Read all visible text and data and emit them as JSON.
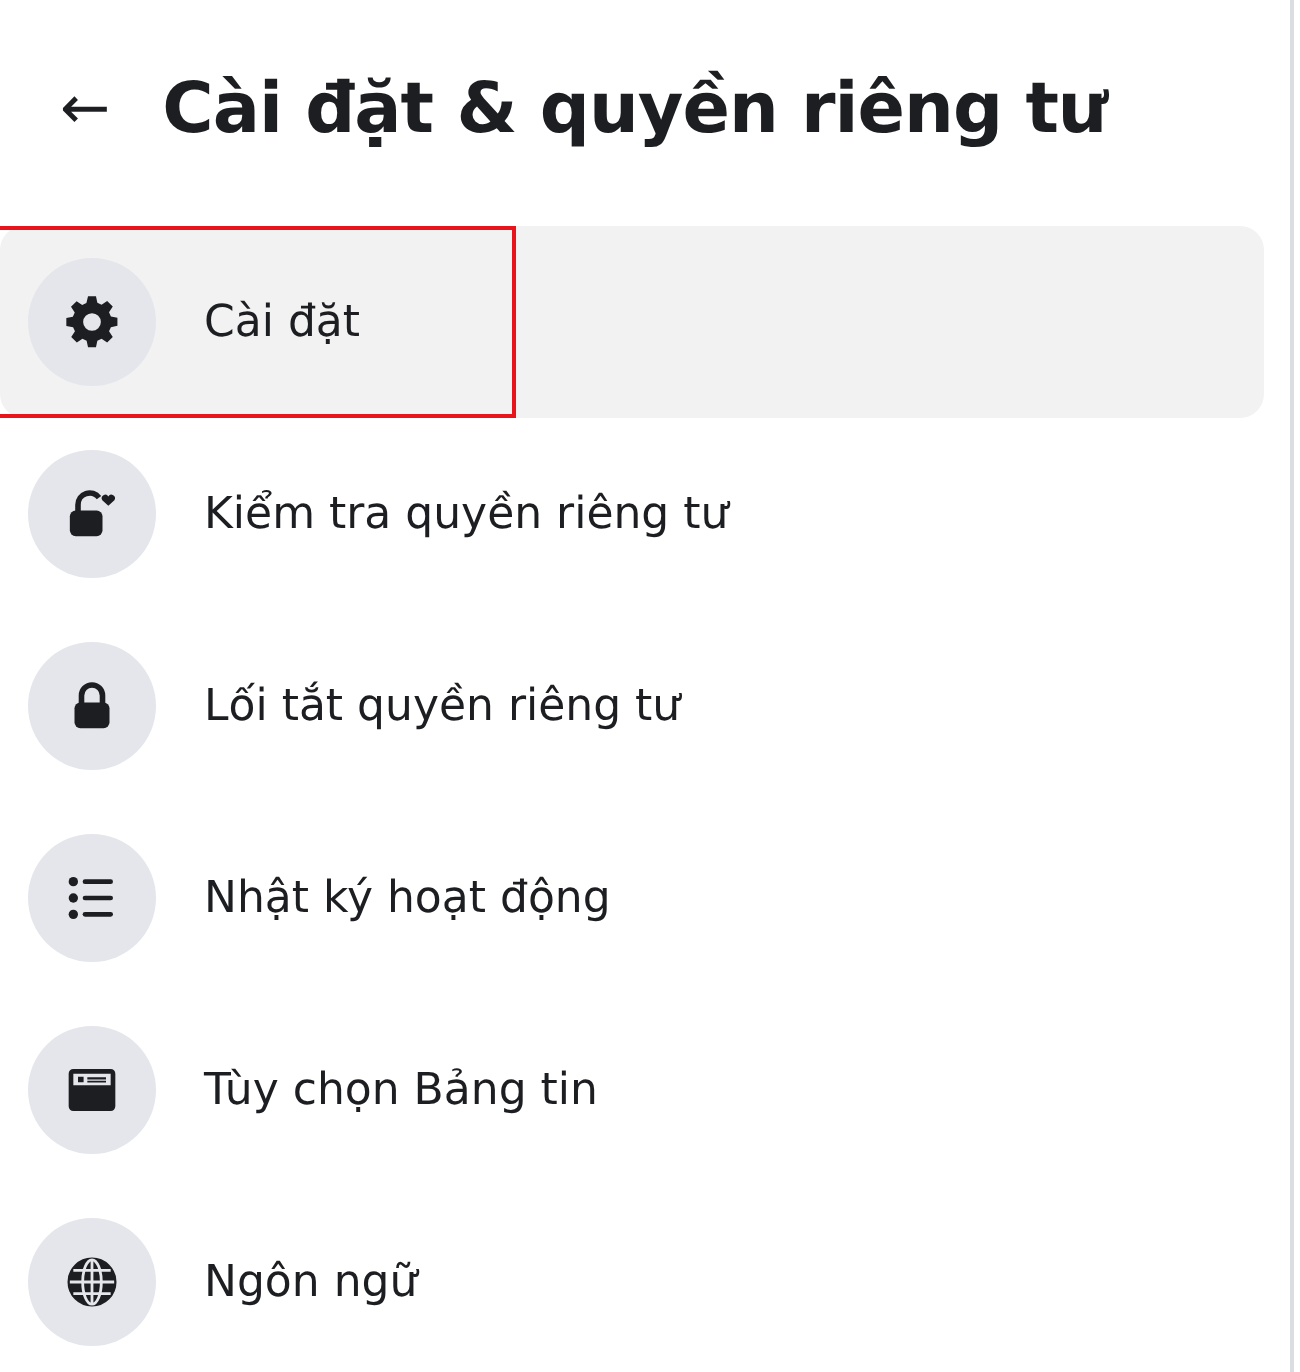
{
  "header": {
    "back": "←",
    "title": "Cài đặt & quyền riêng tư"
  },
  "items": [
    {
      "kind": "gear",
      "label": "Cài đặt",
      "selected": true,
      "annotated": true
    },
    {
      "kind": "lock-heart",
      "label": "Kiểm tra quyền riêng tư",
      "selected": false,
      "annotated": false
    },
    {
      "kind": "lock",
      "label": "Lối tắt quyền riêng tư",
      "selected": false,
      "annotated": false
    },
    {
      "kind": "list",
      "label": "Nhật ký hoạt động",
      "selected": false,
      "annotated": false
    },
    {
      "kind": "feed",
      "label": "Tùy chọn Bảng tin",
      "selected": false,
      "annotated": false
    },
    {
      "kind": "globe",
      "label": "Ngôn ngữ",
      "selected": false,
      "annotated": false
    }
  ]
}
